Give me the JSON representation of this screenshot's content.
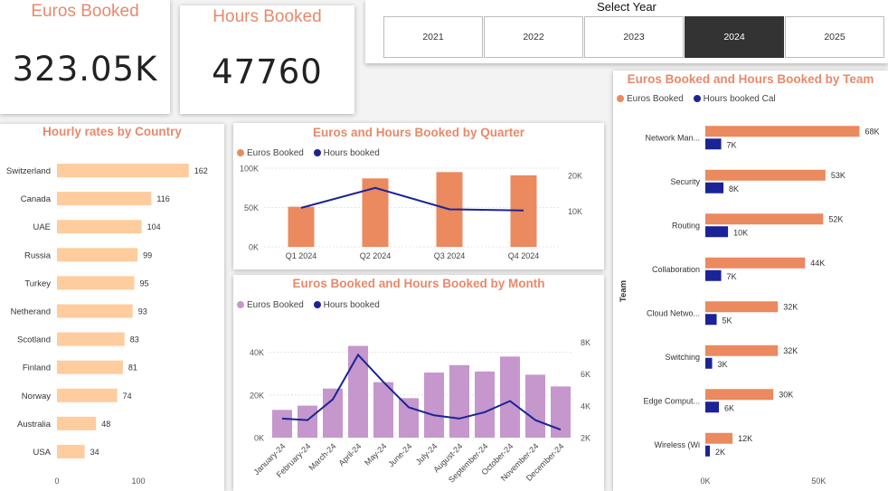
{
  "kpis": {
    "euros_title": "Euros Booked",
    "euros_value": "323.05K",
    "hours_title": "Hours Booked",
    "hours_value": "47760"
  },
  "slicer": {
    "title": "Select Year",
    "years": [
      "2021",
      "2022",
      "2023",
      "2024",
      "2025"
    ],
    "selected": "2024"
  },
  "colors": {
    "accent": "#e8896a",
    "country_bar": "#ffcc9e",
    "quarter_bar": "#eb895f",
    "month_bar": "#c597cd",
    "team_bar": "#eb895f",
    "line": "#1a2496",
    "team_hours": "#1a2496"
  },
  "chart_data": [
    {
      "id": "country",
      "type": "bar",
      "orientation": "horizontal",
      "title": "Hourly rates by Country",
      "categories": [
        "Switzerland",
        "Canada",
        "UAE",
        "Russia",
        "Turkey",
        "Netherand",
        "Scotland",
        "Finland",
        "Norway",
        "Australia",
        "USA"
      ],
      "values": [
        162,
        116,
        104,
        99,
        95,
        93,
        83,
        81,
        74,
        48,
        34
      ],
      "labels": [
        "162",
        "116",
        "104",
        "99",
        "95",
        "93",
        "83",
        "81",
        "74",
        "48",
        "34"
      ],
      "xlim": [
        0,
        190
      ],
      "xticks": [
        0,
        100
      ],
      "xtick_labels": [
        "0",
        "100"
      ]
    },
    {
      "id": "quarter",
      "type": "bar+line",
      "title": "Euros and Hours Booked by Quarter",
      "legend": [
        "Euros Booked",
        "Hours booked"
      ],
      "categories": [
        "Q1 2024",
        "Q2 2024",
        "Q3 2024",
        "Q4 2024"
      ],
      "bars": [
        51000,
        87000,
        95000,
        91000
      ],
      "line": [
        10900,
        16500,
        10500,
        10200
      ],
      "ylim_left": [
        0,
        100000
      ],
      "ylim_right": [
        0,
        22000
      ],
      "left_ticks": [
        0,
        50000,
        100000
      ],
      "left_tick_labels": [
        "0K",
        "50K",
        "100K"
      ],
      "right_ticks": [
        10000,
        20000
      ],
      "right_tick_labels": [
        "10K",
        "20K"
      ]
    },
    {
      "id": "month",
      "type": "bar+line",
      "title": "Euros Booked and Hours Booked by Month",
      "legend": [
        "Euros Booked",
        "Hours booked"
      ],
      "categories": [
        "January-24",
        "February-24",
        "March-24",
        "April-24",
        "May-24",
        "June-24",
        "July-24",
        "August-24",
        "September-24",
        "October-24",
        "November-24",
        "December-24"
      ],
      "bars": [
        13000,
        15000,
        23000,
        43000,
        26000,
        18500,
        30500,
        34000,
        31000,
        38000,
        29500,
        24000
      ],
      "line": [
        3200,
        3100,
        4400,
        7200,
        5500,
        3900,
        3400,
        3200,
        3600,
        4300,
        3100,
        2500
      ],
      "ylim_left": [
        0,
        50000
      ],
      "ylim_right": [
        2000,
        8700
      ],
      "left_ticks": [
        0,
        20000,
        40000
      ],
      "left_tick_labels": [
        "0K",
        "20K",
        "40K"
      ],
      "right_ticks": [
        2000,
        4000,
        6000,
        8000
      ],
      "right_tick_labels": [
        "2K",
        "4K",
        "6K",
        "8K"
      ]
    },
    {
      "id": "team",
      "type": "bar",
      "orientation": "horizontal-grouped",
      "title": "Euros Booked and Hours Booked by Team",
      "legend": [
        "Euros Booked",
        "Hours booked Cal"
      ],
      "ylabel": "Team",
      "categories": [
        "Network Man...",
        "Security",
        "Routing",
        "Collaboration",
        "Cloud Netwo...",
        "Switching",
        "Edge Comput...",
        "Wireless (Wi"
      ],
      "euros": [
        68000,
        53000,
        52000,
        44000,
        32000,
        32000,
        30000,
        12000
      ],
      "hours": [
        7000,
        8000,
        10000,
        7000,
        5000,
        3000,
        6000,
        2000
      ],
      "euros_labels": [
        "68K",
        "53K",
        "52K",
        "44K",
        "32K",
        "32K",
        "30K",
        "12K"
      ],
      "hours_labels": [
        "7K",
        "8K",
        "10K",
        "7K",
        "5K",
        "3K",
        "6K",
        "2K"
      ],
      "xlim": [
        0,
        75000
      ],
      "xticks": [
        0,
        50000
      ],
      "xtick_labels": [
        "0K",
        "50K"
      ]
    }
  ]
}
